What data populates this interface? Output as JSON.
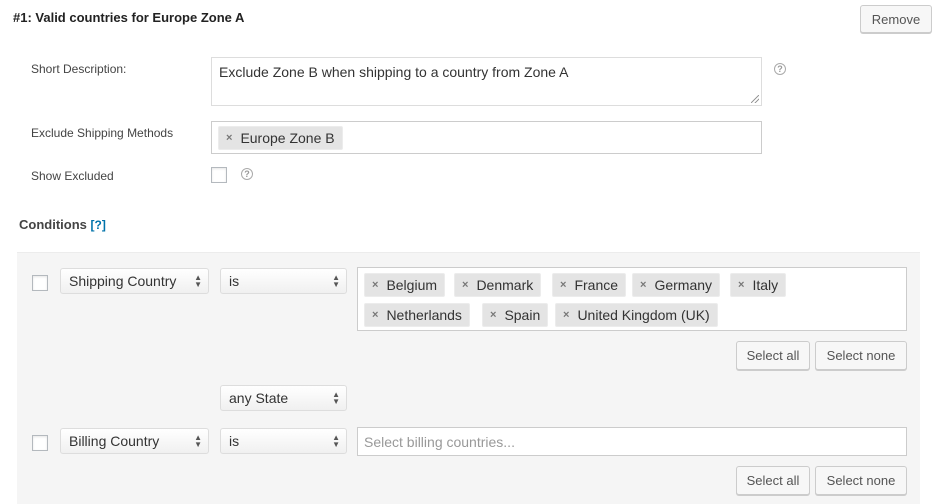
{
  "rule": {
    "title": "#1: Valid countries for Europe Zone A",
    "remove_label": "Remove"
  },
  "fields": {
    "short_description_label": "Short Description:",
    "short_description_value": "Exclude Zone B when shipping to a country from Zone A",
    "exclude_methods_label": "Exclude Shipping Methods",
    "exclude_methods_chips": [
      "Europe Zone B"
    ],
    "show_excluded_label": "Show Excluded",
    "help_glyph": "?"
  },
  "conditions": {
    "heading": "Conditions",
    "help_link": "[?]",
    "shipping": {
      "field": "Shipping Country",
      "operator": "is",
      "countries": [
        "Belgium",
        "Denmark",
        "France",
        "Germany",
        "Italy",
        "Netherlands",
        "Spain",
        "United Kingdom (UK)"
      ],
      "select_all": "Select all",
      "select_none": "Select none",
      "state": "any State"
    },
    "billing": {
      "field": "Billing Country",
      "operator": "is",
      "placeholder": "Select billing countries...",
      "select_all": "Select all",
      "select_none": "Select none"
    }
  },
  "icons": {
    "remove_chip": "×",
    "select_arrows": "updown-arrows"
  }
}
